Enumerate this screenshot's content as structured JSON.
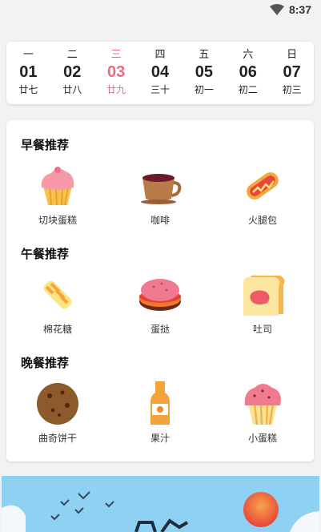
{
  "status_bar": {
    "time": "8:37"
  },
  "calendar": {
    "days": [
      {
        "weekday": "一",
        "date": "01",
        "lunar": "廿七"
      },
      {
        "weekday": "二",
        "date": "02",
        "lunar": "廿八"
      },
      {
        "weekday": "三",
        "date": "03",
        "lunar": "廿九"
      },
      {
        "weekday": "四",
        "date": "04",
        "lunar": "三十"
      },
      {
        "weekday": "五",
        "date": "05",
        "lunar": "初一"
      },
      {
        "weekday": "六",
        "date": "06",
        "lunar": "初二"
      },
      {
        "weekday": "日",
        "date": "07",
        "lunar": "初三"
      }
    ],
    "active_color": "#e86b84"
  },
  "sections": [
    {
      "title": "早餐推荐",
      "items": [
        {
          "label": "切块蛋糕",
          "icon": "cupcake-icon"
        },
        {
          "label": "咖啡",
          "icon": "coffee-cup-icon"
        },
        {
          "label": "火腿包",
          "icon": "hotdog-icon"
        }
      ]
    },
    {
      "title": "午餐推荐",
      "items": [
        {
          "label": "棉花糖",
          "icon": "candy-icon"
        },
        {
          "label": "蛋挞",
          "icon": "macaron-icon"
        },
        {
          "label": "吐司",
          "icon": "toast-icon"
        }
      ]
    },
    {
      "title": "晚餐推荐",
      "items": [
        {
          "label": "曲奇饼干",
          "icon": "cookie-icon"
        },
        {
          "label": "果汁",
          "icon": "juice-bottle-icon"
        },
        {
          "label": "小蛋糕",
          "icon": "muffin-icon"
        }
      ]
    }
  ]
}
